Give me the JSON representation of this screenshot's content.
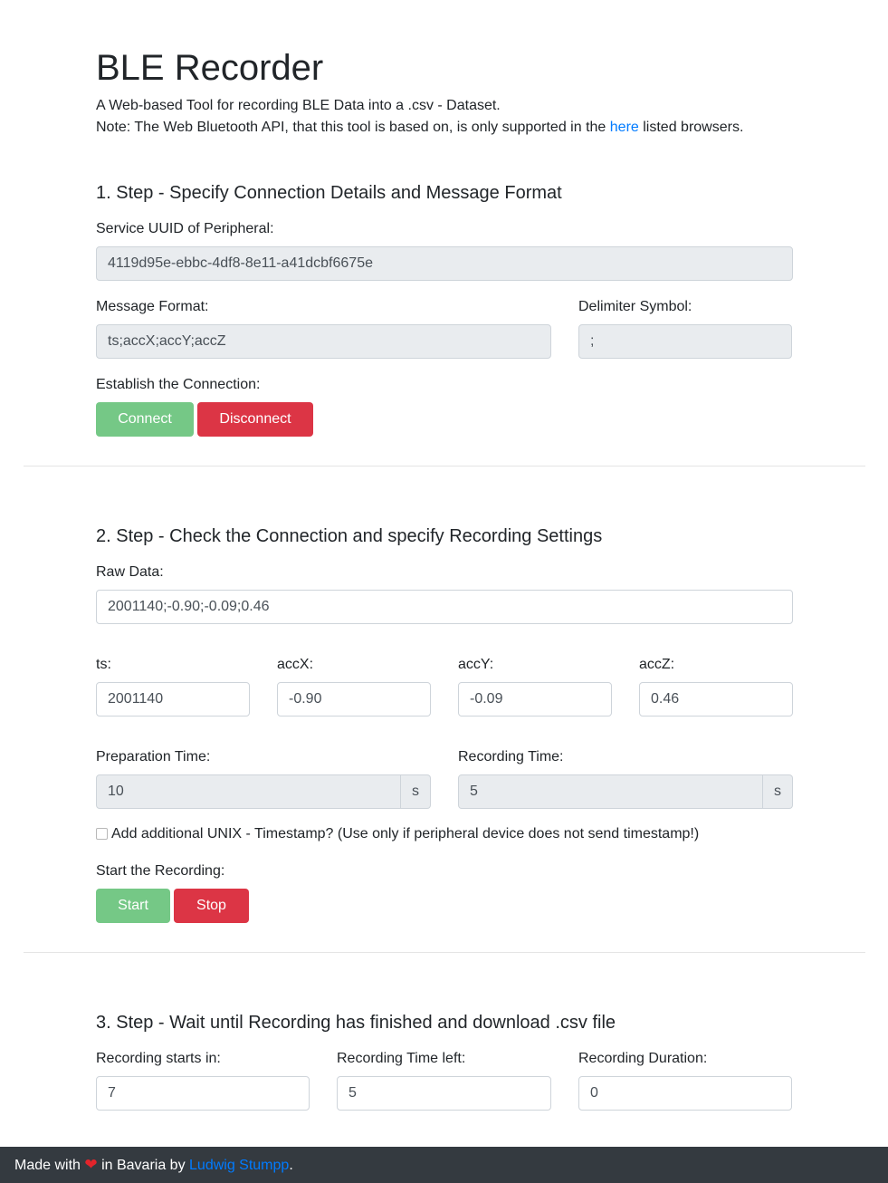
{
  "header": {
    "title": "BLE Recorder",
    "description_line1": "A Web-based Tool for recording BLE Data into a .csv - Dataset.",
    "note_before": "Note: The Web Bluetooth API, that this tool is based on, is only supported in the ",
    "note_link": "here",
    "note_after": " listed browsers."
  },
  "step1": {
    "title": "1. Step - Specify Connection Details and Message Format",
    "uuid_label": "Service UUID of Peripheral:",
    "uuid_value": "4119d95e-ebbc-4df8-8e11-a41dcbf6675e",
    "format_label": "Message Format:",
    "format_value": "ts;accX;accY;accZ",
    "delimiter_label": "Delimiter Symbol:",
    "delimiter_value": ";",
    "connection_label": "Establish the Connection:",
    "connect_button": "Connect",
    "disconnect_button": "Disconnect"
  },
  "step2": {
    "title": "2. Step - Check the Connection and specify Recording Settings",
    "raw_label": "Raw Data:",
    "raw_value": "2001140;-0.90;-0.09;0.46",
    "fields": [
      {
        "label": "ts:",
        "value": "2001140"
      },
      {
        "label": "accX:",
        "value": "-0.90"
      },
      {
        "label": "accY:",
        "value": "-0.09"
      },
      {
        "label": "accZ:",
        "value": "0.46"
      }
    ],
    "prep_label": "Preparation Time:",
    "prep_value": "10",
    "prep_unit": "s",
    "rec_label": "Recording Time:",
    "rec_value": "5",
    "rec_unit": "s",
    "timestamp_checkbox_label": "Add additional UNIX - Timestamp? (Use only if peripheral device does not send timestamp!)",
    "start_label": "Start the Recording:",
    "start_button": "Start",
    "stop_button": "Stop"
  },
  "step3": {
    "title": "3. Step - Wait until Recording has finished and download .csv file",
    "starts_label": "Recording starts in:",
    "starts_value": "7",
    "left_label": "Recording Time left:",
    "left_value": "5",
    "duration_label": "Recording Duration:",
    "duration_value": "0"
  },
  "footer": {
    "made_with": "Made with",
    "heart_icon": "heart-icon",
    "in_bavaria": " in Bavaria by ",
    "author": "Ludwig Stumpp",
    "period": "."
  },
  "colors": {
    "success_button": "#75c886",
    "danger_button": "#dc3545",
    "link": "#007bff",
    "footer_bg": "#343a40",
    "readonly_bg": "#e9ecef"
  }
}
